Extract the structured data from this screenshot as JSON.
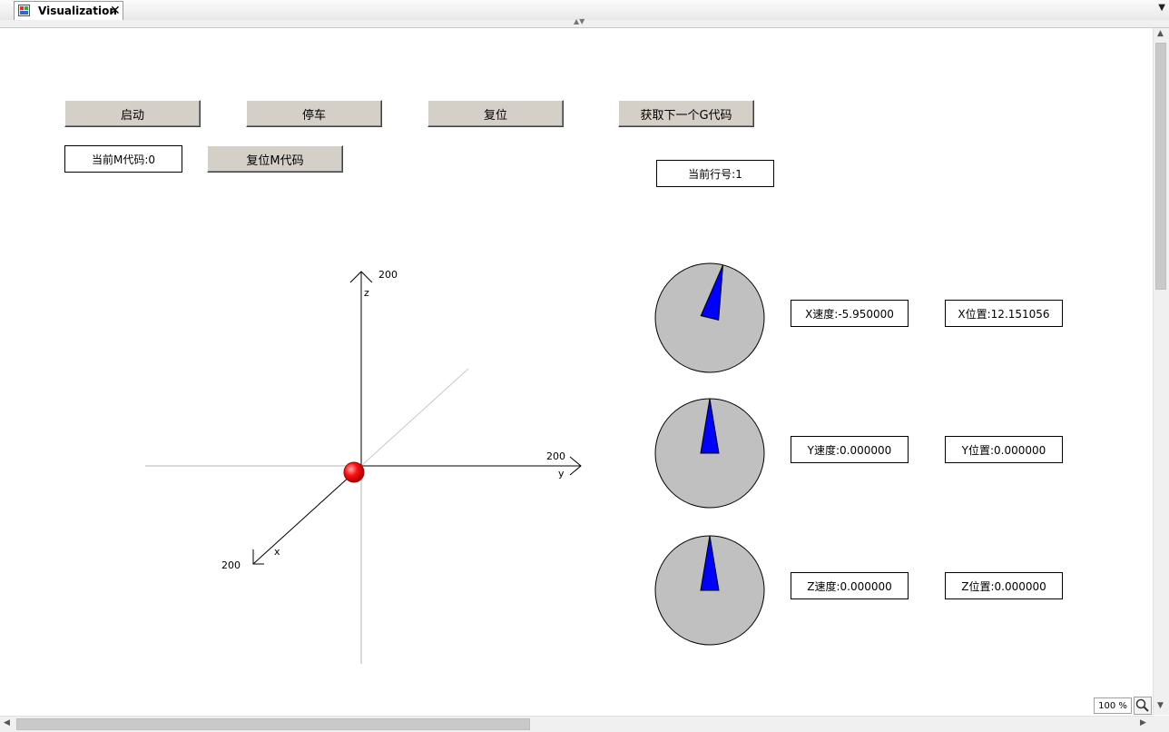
{
  "tab": {
    "title": "Visualization",
    "close": "✕"
  },
  "buttons": {
    "start": "启动",
    "stop": "停车",
    "reset": "复位",
    "next_g": "获取下一个G代码",
    "reset_m": "复位M代码"
  },
  "displays": {
    "current_m": "当前M代码:0",
    "current_line": "当前行号:1",
    "x_speed": "X速度:-5.950000",
    "x_position": "X位置:12.151056",
    "y_speed": "Y速度:0.000000",
    "y_position": "Y位置:0.000000",
    "z_speed": "Z速度:0.000000",
    "z_position": "Z位置:0.000000"
  },
  "axes": {
    "z_max": "200",
    "z_label": "z",
    "y_max": "200",
    "y_label": "y",
    "x_max": "200",
    "x_label": "x"
  },
  "gauges": {
    "x_needle_angle_deg": 14,
    "y_needle_angle_deg": 0,
    "z_needle_angle_deg": 0
  },
  "colors": {
    "gauge_face": "#c0c0c0",
    "needle": "#0000ff",
    "tool_point": "#ff0000",
    "button_face": "#d4d0c8"
  },
  "zoom": {
    "level": "100 %"
  }
}
